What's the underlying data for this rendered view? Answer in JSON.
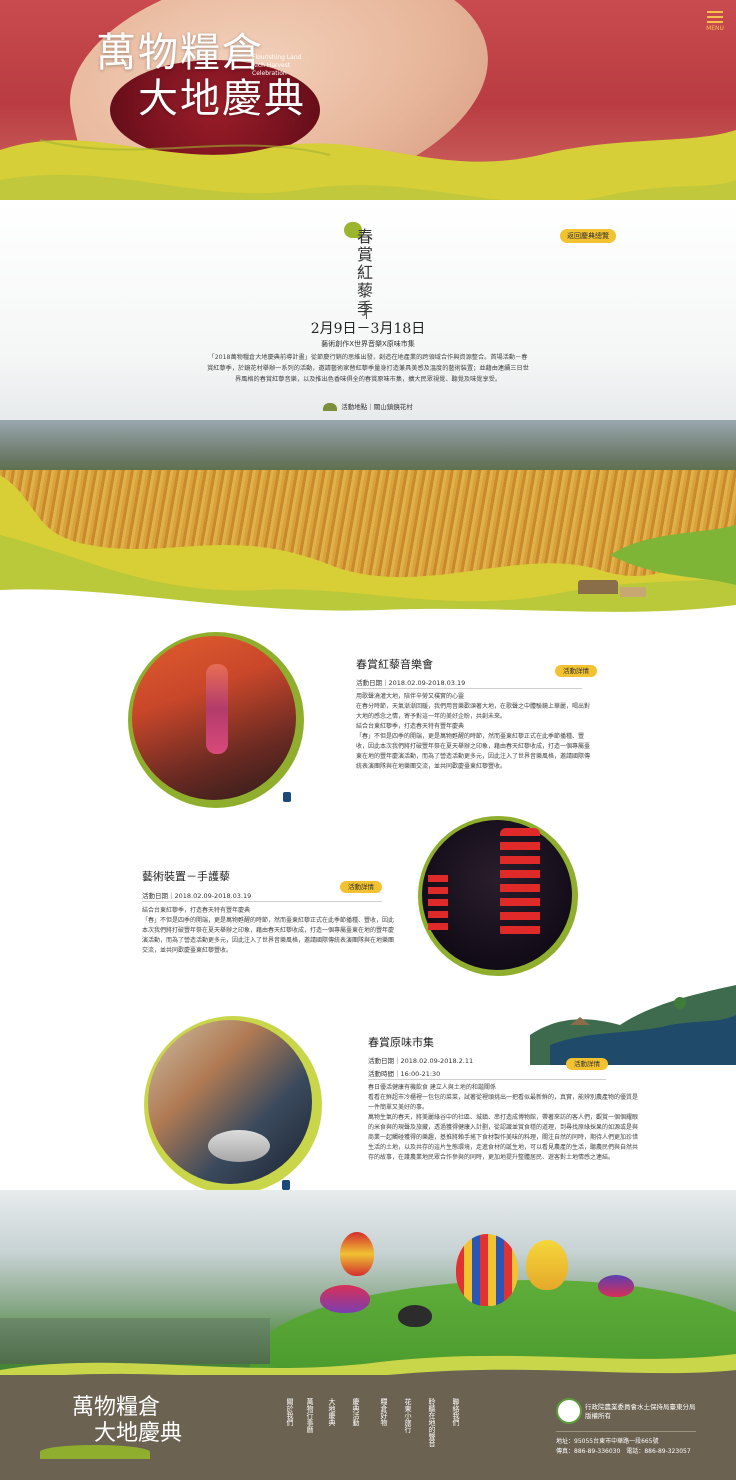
{
  "brand": {
    "title_line1": "萬物糧倉",
    "title_line2": "大地慶典",
    "subtitle": "Flourishing Land Rich Harvest Celebration",
    "menu_label": "MENU"
  },
  "colors": {
    "accent": "#f2c230",
    "ribbon_yellow": "#d7cf35",
    "ribbon_green": "#b7c93a",
    "footer": "#6b6252"
  },
  "section1": {
    "back_button": "返回慶典總覽",
    "title_vertical": "春賞紅藜季",
    "dates": "2月9日－3月18日",
    "tagline": "藝術創作X世界音樂X原味市集",
    "intro": "「2018萬物糧倉大地慶典前導計畫」從節慶行銷的思維出發，創造在地產業的跨領域合作與資源整合。首場活動－春賞紅藜季，於鏡花村舉辦一系列的活動，邀請藝術家替紅藜季量身打造兼具美感及溫度的藝術裝置；並藉由連續三日世界風格的春賞紅藜音樂，以及推出色香味俱全的春賞原味市集，擴大民眾視覺、聽覺及味覺享受。",
    "location": "活動地點｜關山鎮鏡花村"
  },
  "events": [
    {
      "title": "春賞紅藜音樂會",
      "date": "活動日期｜2018.02.09-2018.03.19",
      "detail_label": "活動詳情",
      "body": "用歌聲澆灌大地，陪伴辛勞又樸實的心靈\n在春分時節，天氣漸漸回暖，我們用音樂歡頌著大地，在歌聲之中體驗鏡上華麗，喝出對大地的感念之情，寄予對這一年的美好企盼，共創未來。\n結合台東紅藜季，打造春天特有豐年慶典\n「春」不但是四季的開端，更是萬物甦醒的時節，然而臺東紅藜正式在此季節播種、豐收，因此本次我們將打破豐年祭在夏天舉辦之印象，藉由春天紅藜收成，打造一個專屬臺東在地的豐年慶演活動，而為了營造活動更多元，因此注入了世界音樂風格，邀請國際傳統表演團隊與在地樂團交流，並共同歡慶臺東紅藜豐收。"
    },
    {
      "title": "藝術裝置－手護藜",
      "date": "活動日期｜2018.02.09-2018.03.19",
      "detail_label": "活動詳情",
      "body": "結合台東紅藜季，打造春天特有豐年慶典\n「春」不但是四季的開端，更是萬物甦醒的時節，然而臺東紅藜正式在此季節播種、豐收，因此本次我們將打破豐年祭在夏天舉辦之印象，藉由春天紅藜收成，打造一個專屬臺東在地的豐年慶演活動，而為了營造活動更多元，因此注入了世界音樂風格，邀請國際傳統表演團隊與在地樂團交流，並共同歡慶臺東紅藜豐收。"
    },
    {
      "title": "春賞原味市集",
      "date": "活動日期｜2018.02.09-2018.2.11",
      "time": "活動時間｜16:00-21:30",
      "detail_label": "活動詳情",
      "body": "春日優活健康有機飲食 建立人與土地的和諧關係\n看看在鮮超市冷櫃裡一包包的菜菜，試著從裡頭挑出一把看似最新鮮的，真實，能辨別農產物的優質是一件簡單又美好的事。\n萬物生氣的春天，將美麗綠谷中的社區、城鎮、串打造成博物館，帶著來訪的客人們，觀賞一個個耀眼的米食與的現聲及旅藏，透過獲得健康入計劃，從認識並賞食穩的道理，到尋找原綠採果的如源或是與商業一起觸碰獲得的樂趣，基推將賴手搖下食材製作美味的料理，關注自然的同時，期待人們更加珍惜生活的土地，以及共存的這片生態環境，走進食材的誕生地，可以看見農產的生活，聽農民們與自然共存的故事，在護農業地民眾合作參與的同時，更加地提升整體居民、遊客對土地情感之連結。"
    }
  ],
  "footer": {
    "nav": [
      "關於我們",
      "萬物行事曆",
      "大地慶典",
      "慶典活動",
      "糧倉好物",
      "花東小旅行",
      "聆聽在地的聲音",
      "聯絡我們"
    ],
    "org_line1": "行政院農業委員會水土保持局臺東分局",
    "org_line2": "版權所有",
    "address": "地址：95055台東市中華路一段665號",
    "phone": "傳真：886-89-336030　電話：886-89-323057"
  }
}
